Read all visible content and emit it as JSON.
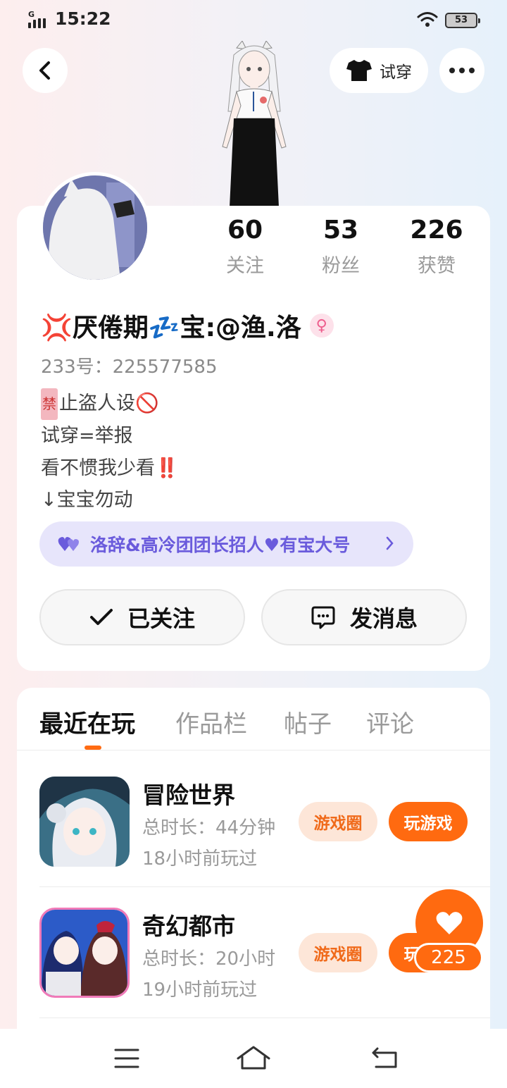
{
  "status_bar": {
    "time": "15:22",
    "network": "G",
    "battery": "53"
  },
  "header": {
    "try_on_label": "试穿"
  },
  "profile": {
    "stats": [
      {
        "value": "60",
        "label": "关注"
      },
      {
        "value": "53",
        "label": "粉丝"
      },
      {
        "value": "226",
        "label": "获赞"
      }
    ],
    "nickname": "💢厌倦期💤宝:@渔.洛",
    "gender_symbol": "♀",
    "uid": "233号：225577585",
    "bio": {
      "ban_char": "禁",
      "line1_rest": "止盗人设🚫",
      "line2": "试穿=举报",
      "line3": "看不惯我少看‼️",
      "line4": "↓宝宝勿动"
    },
    "group_label": "洛辞&高冷团团长招人♥有宝大号",
    "followed_label": "已关注",
    "message_label": "发消息"
  },
  "tabs": [
    {
      "label": "最近在玩",
      "active": true
    },
    {
      "label": "作品栏",
      "active": false
    },
    {
      "label": "帖子",
      "active": false
    },
    {
      "label": "评论",
      "active": false
    }
  ],
  "games": [
    {
      "name": "冒险世界",
      "duration": "总时长：44分钟",
      "last_played": "18小时前玩过",
      "circle_label": "游戏圈",
      "play_label": "玩游戏"
    },
    {
      "name": "奇幻都市",
      "duration": "总时长：20小时",
      "last_played": "19小时前玩过",
      "circle_label": "游戏圈",
      "play_label": "玩游戏"
    }
  ],
  "like": {
    "count": "225"
  },
  "colors": {
    "accent": "#ff6a10",
    "pill_bg": "#e7e5fb",
    "pill_text": "#6a5bdc"
  },
  "icons": {
    "back": "back-arrow-icon",
    "shirt": "shirt-icon",
    "more": "more-icon",
    "check": "check-icon",
    "chat": "chat-icon",
    "heart": "heart-icon",
    "menu": "menu-icon",
    "home": "home-icon",
    "return": "return-icon"
  }
}
